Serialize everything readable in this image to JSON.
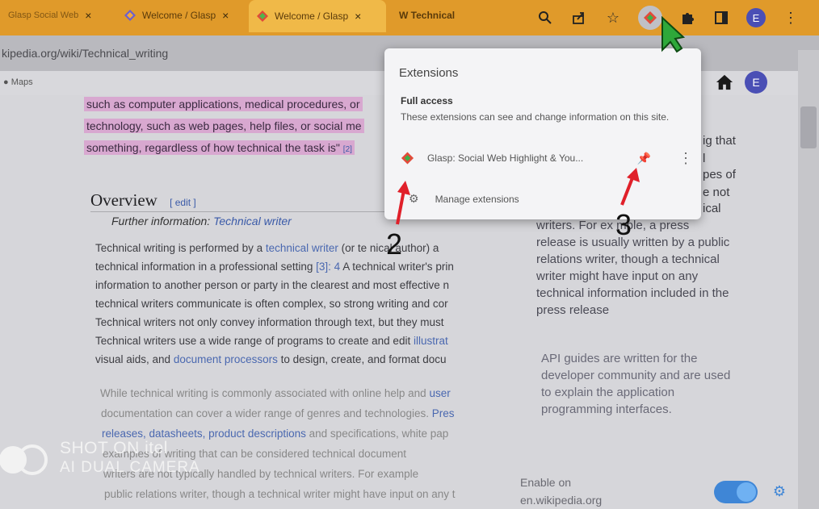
{
  "tabs": [
    {
      "label": "Glasp Social Web",
      "close": "×"
    },
    {
      "label": "Welcome / Glasp",
      "close": "×"
    },
    {
      "label": "Welcome / Glasp",
      "close": "×"
    },
    {
      "label": "W  Technical",
      "close": ""
    }
  ],
  "toolbar": {
    "icons": [
      "search-icon",
      "share-icon",
      "star-icon",
      "glasp-extension-icon",
      "puzzle-extensions-icon",
      "sidepanel-icon"
    ],
    "avatar_letter": "E",
    "menu": "⋮"
  },
  "address_bar": {
    "url": "kipedia.org/wiki/Technical_writing"
  },
  "bookmarks": {
    "maps": "Maps"
  },
  "article": {
    "highlight_lines": [
      "such as computer applications, medical procedures, or",
      "technology, such as web pages, help files, or social me",
      "something, regardless of how technical the task is\""
    ],
    "cite2": "[2]",
    "overview_heading": "Overview",
    "edit_label": "[ edit ]",
    "further_prefix": "Further information: ",
    "further_link": "Technical writer",
    "paragraphs": [
      {
        "pre": "Technical writing is performed by a ",
        "link": "technical writer",
        "post": " (or te   nical author) a"
      },
      {
        "pre": "technical information in a professional setting ",
        "link": "[3]: 4",
        "post": " A technical writer's prin"
      },
      {
        "pre": "information to another person or party in the clearest and most effective n",
        "link": "",
        "post": ""
      },
      {
        "pre": "technical writers communicate is often complex, so strong writing and cor",
        "link": "",
        "post": ""
      },
      {
        "pre": "Technical writers not only convey information through text, but they must ",
        "link": "",
        "post": ""
      },
      {
        "pre": "Technical writers use a wide range of programs to create and edit ",
        "link": "illustrat",
        "post": ""
      },
      {
        "pre": "visual aids, and ",
        "link": "document processors",
        "post": " to design, create, and format docu"
      }
    ],
    "faded_paragraphs": [
      {
        "pre": "While technical writing is commonly associated with online help and ",
        "link": "user",
        "post": ""
      },
      {
        "pre": "documentation can cover a wider range of genres and technologies. ",
        "link": "Pres",
        "post": ""
      },
      {
        "pre": "",
        "link": "releases, datasheets, product descriptions",
        "post": " and specifications, white pap"
      },
      {
        "pre": "     examples of writing that can be considered technical document",
        "link": "",
        "post": ""
      },
      {
        "pre": "    writers are not typically handled by technical writers. For example",
        "link": "",
        "post": ""
      },
      {
        "pre": "public relations writer, though a technical writer might have input on any t",
        "link": "",
        "post": ""
      }
    ],
    "right_fragments": [
      "ig that",
      "l",
      "pes of",
      "e not",
      "ical"
    ],
    "right_col": [
      "typically handled by technical",
      "writers. For ex  mple, a press",
      "release is usually written by a public",
      "relations writer, though a technical",
      "writer might have input on any",
      "technical information included in the",
      "press release"
    ],
    "right_col2": [
      "API guides are written for the",
      "developer community and are used",
      "to explain the application",
      "programming interfaces."
    ],
    "enable_on": "Enable on",
    "enable_site": "en.wikipedia.org",
    "wiki_avatar": "E"
  },
  "extensions_popup": {
    "title": "Extensions",
    "full_access": "Full access",
    "description": "These extensions can see and change information on this site.",
    "extension_name": "Glasp: Social Web Highlight & You...",
    "pin_icon": "pin-icon",
    "manage_label": "Manage extensions"
  },
  "annotations": {
    "two": "2",
    "three": "3"
  },
  "watermark": {
    "line1": "SHOT ON itel",
    "line2": "AI DUAL CAMERA"
  }
}
